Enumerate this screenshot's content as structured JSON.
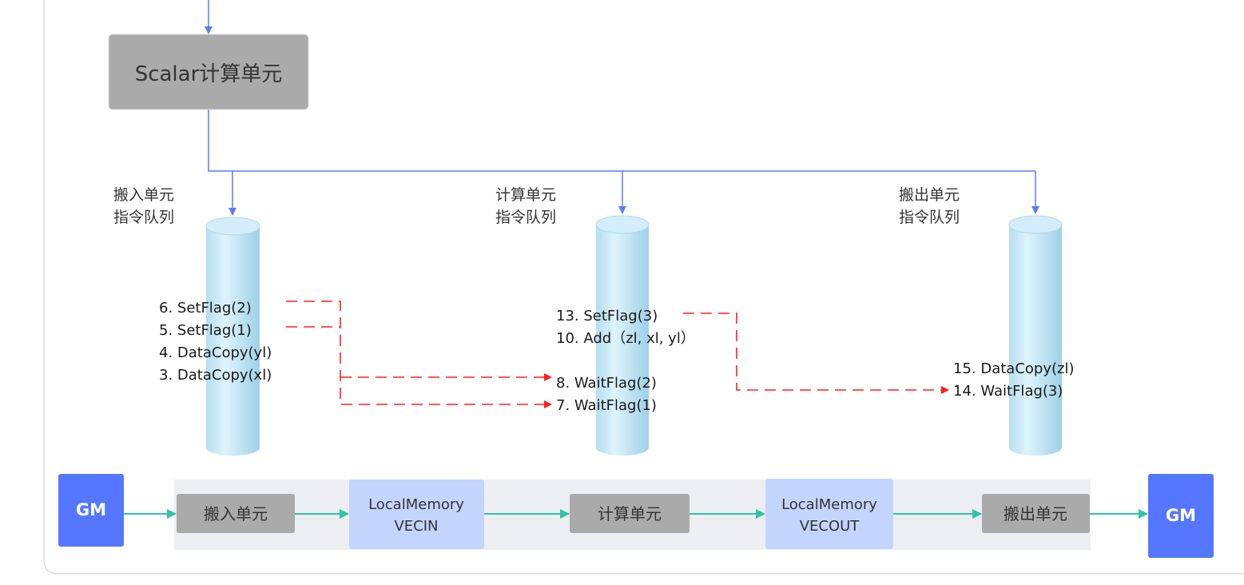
{
  "scalar_unit": "Scalar计算单元",
  "queues": [
    {
      "label_line1": "搬入单元",
      "label_line2": "指令队列",
      "commands": [
        "6. SetFlag(2)",
        "5. SetFlag(1)",
        "4. DataCopy(yl)",
        "3. DataCopy(xl)"
      ]
    },
    {
      "label_line1": "计算单元",
      "label_line2": "指令队列",
      "commands": [
        "13. SetFlag(3)",
        "10.  Add（zl, xl, yl）",
        "8. WaitFlag(2)",
        "7. WaitFlag(1)"
      ]
    },
    {
      "label_line1": "搬出单元",
      "label_line2": "指令队列",
      "commands": [
        "15. DataCopy(zl)",
        "14.  WaitFlag(3)"
      ]
    }
  ],
  "pipeline": {
    "gm_in": "GM",
    "copy_in": "搬入单元",
    "vecin_line1": "LocalMemory",
    "vecin_line2": "VECIN",
    "compute": "计算单元",
    "vecout_line1": "LocalMemory",
    "vecout_line2": "VECOUT",
    "copy_out": "搬出单元",
    "gm_out": "GM"
  },
  "colors": {
    "control_line": "#5b7cf7",
    "sync_line": "#ff2020",
    "data_flow": "#2ec4a6",
    "gm": "#5577ff",
    "local_memory": "#c3d5fd",
    "unit": "#aaaaaa"
  }
}
